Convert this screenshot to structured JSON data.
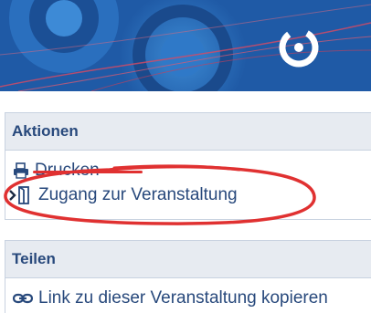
{
  "colors": {
    "banner_blue": "#1f5aa6",
    "panel_header_bg": "#e7ebf1",
    "link_text": "#28497c",
    "annotation_red": "#e03131"
  },
  "banner": {
    "logo_icon": "brand-logo-ring"
  },
  "actions_panel": {
    "title": "Aktionen",
    "items": [
      {
        "label": "Drucken",
        "icon": "print-icon"
      },
      {
        "label": "Zugang zur Veranstaltung",
        "icon": "door-enter-icon"
      }
    ]
  },
  "share_panel": {
    "title": "Teilen",
    "items": [
      {
        "label": "Link zu dieser Veranstaltung kopieren",
        "icon": "link-icon"
      }
    ]
  }
}
